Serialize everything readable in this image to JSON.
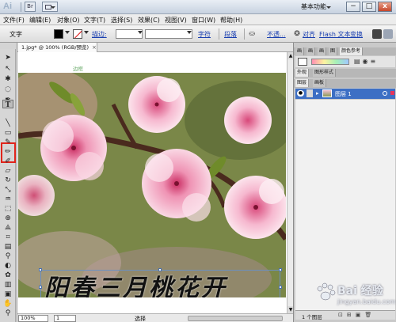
{
  "titlebar": {
    "app_logo": "Ai",
    "bridge_label": "Br",
    "workspace": "基本功能",
    "minimize": "−",
    "maximize": "□",
    "close": "x"
  },
  "menu": [
    "文件(F)",
    "编辑(E)",
    "对象(O)",
    "文字(T)",
    "选择(S)",
    "效果(C)",
    "视图(V)",
    "窗口(W)",
    "帮助(H)"
  ],
  "control_bar": {
    "tool_label": "文字",
    "stroke_label": "描边:",
    "char_label": "字符",
    "para_label": "段落",
    "opacity_label": "不透...",
    "align_label": "对齐",
    "flash_label": "Flash 文本",
    "transform_label": "变换"
  },
  "toolbox": {
    "tools": [
      "selection-tool",
      "direct-selection-tool",
      "magic-wand-tool",
      "lasso-tool",
      "pen-tool",
      "type-tool",
      "line-tool",
      "rectangle-tool",
      "paintbrush-tool",
      "pencil-tool",
      "blob-brush-tool",
      "eraser-tool",
      "rotate-tool",
      "scale-tool",
      "warp-tool",
      "free-transform-tool",
      "shape-builder-tool",
      "perspective-tool",
      "mesh-tool",
      "gradient-tool",
      "eyedropper-tool",
      "blend-tool",
      "symbol-sprayer-tool",
      "graph-tool",
      "artboard-tool",
      "slice-tool",
      "hand-tool",
      "zoom-tool",
      "fill-stroke",
      "screen-mode"
    ],
    "selected": "T"
  },
  "document": {
    "tab_title": "1.jpg* @ 100% (RGB/预览)",
    "tab_close": "×",
    "artboard_label": "边框",
    "caption": "阳春三月桃花开",
    "zoom": "100%",
    "page": "1",
    "status": "选择"
  },
  "panels": {
    "top_tabs": [
      "画",
      "画",
      "画",
      "图",
      "颜色参考"
    ],
    "mid_tabs": [
      "外观",
      "图形样式"
    ],
    "layer_tabs": [
      "图层",
      "画板"
    ],
    "layer_name": "图层 1",
    "layer_count": "1 个图层"
  },
  "watermark": {
    "brand": "Bai 经验",
    "url": "jingyan.baidu.com"
  },
  "colors": {
    "selection_blue": "#3d6fc4",
    "highlight_red": "#e0241b",
    "blossom_pink": "#f3b6cc"
  }
}
